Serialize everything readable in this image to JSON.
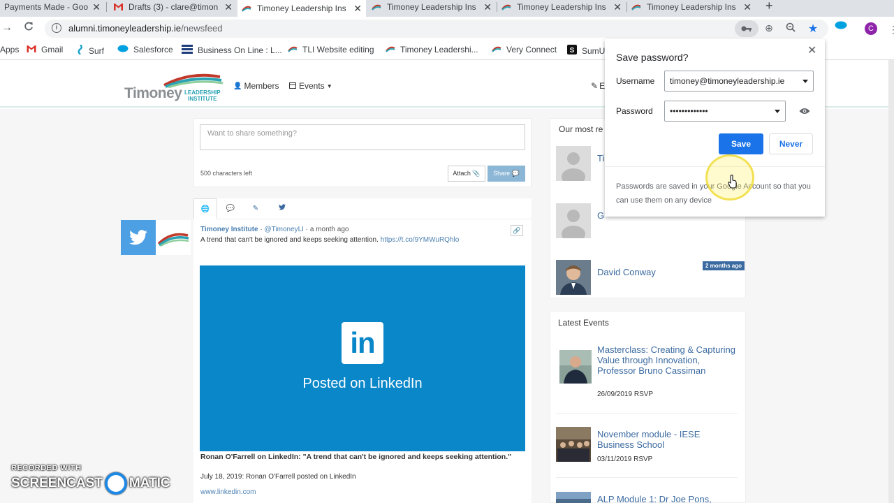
{
  "browser": {
    "tabs": [
      {
        "title": "Payments Made - Goog",
        "icon": "payments-favicon"
      },
      {
        "title": "Drafts (3) - clare@timon",
        "icon": "gmail-icon"
      },
      {
        "title": "Timoney Leadership Ins",
        "icon": "tli-favicon",
        "active": true
      },
      {
        "title": "Timoney Leadership Ins",
        "icon": "tli-favicon"
      },
      {
        "title": "Timoney Leadership Ins",
        "icon": "tli-favicon"
      },
      {
        "title": "Timoney Leadership Ins",
        "icon": "tli-favicon"
      }
    ],
    "new_tab": "+",
    "close_glyph": "✕",
    "url_host": "alumni.timoneyleadership.ie",
    "url_path": "/newsfeed",
    "profile_initial": "C",
    "bookmarks": [
      {
        "label": "Apps",
        "icon": "apps-grid-icon"
      },
      {
        "label": "Gmail",
        "icon": "gmail-icon"
      },
      {
        "label": "Surf",
        "icon": "surf-icon"
      },
      {
        "label": "Salesforce",
        "icon": "salesforce-icon"
      },
      {
        "label": "Business On Line : L...",
        "icon": "bank-icon"
      },
      {
        "label": "TLI Website editing",
        "icon": "tli-favicon"
      },
      {
        "label": "Timoney Leadershi...",
        "icon": "tli-favicon"
      },
      {
        "label": "Very Connect",
        "icon": "tli-favicon"
      },
      {
        "label": "SumU",
        "icon": "sumup-icon"
      }
    ]
  },
  "site": {
    "logo_word": "Timoney",
    "logo_sub_1": "LEADERSHIP",
    "logo_sub_2": "INSTITUTE",
    "nav": {
      "members": "Members",
      "events": "Events",
      "edit_partial": "E"
    },
    "share": {
      "placeholder": "Want to share something?",
      "chars_left": "500 characters left",
      "attach": "Attach",
      "share": "Share"
    },
    "post": {
      "author": "Timoney Institute",
      "handle": "@TimoneyLI",
      "time": "a month ago",
      "text": "A trend that can't be ignored and keeps seeking attention.",
      "link": "https://t.co/9YMWuRQhlo",
      "card_caption": "Posted on LinkedIn",
      "card_logo": "in",
      "card_title": "Ronan O'Farrell on LinkedIn: \"A trend that can't be ignored and keeps seeking attention.\"",
      "card_date": "July 18, 2019: Ronan O'Farrell posted on LinkedIn",
      "card_domain": "www.linkedin.com"
    },
    "members_panel": {
      "heading": "Our most re",
      "members": [
        {
          "name": "Ti",
          "badge": ""
        },
        {
          "name": "G",
          "badge": ""
        },
        {
          "name": "David Conway",
          "badge": "2 months ago"
        }
      ]
    },
    "events_panel": {
      "heading": "Latest Events",
      "events": [
        {
          "title": "Masterclass: Creating & Capturing Value through Innovation, Professor Bruno Cassiman",
          "date": "26/09/2019",
          "rsvp": "RSVP"
        },
        {
          "title": "November module - IESE Business School",
          "date": "03/11/2019",
          "rsvp": "RSVP"
        },
        {
          "title": "ALP Module 1: Dr Joe Pons,",
          "date": "",
          "rsvp": ""
        }
      ]
    }
  },
  "password_dialog": {
    "title": "Save password?",
    "username_label": "Username",
    "username_value": "timoney@timoneyleadership.ie",
    "password_label": "Password",
    "password_value": "•••••••••••••",
    "save": "Save",
    "never": "Never",
    "footer": "Passwords are saved in your Google Account so that you can use them on any device"
  },
  "watermark": {
    "line1": "RECORDED WITH",
    "line2_a": "SCREENCAST",
    "line2_b": "MATIC"
  },
  "colors": {
    "accent": "#1a73e8",
    "link": "#3b6aa0",
    "linkedin": "#0a87c8",
    "twitter": "#4ea0e4"
  }
}
